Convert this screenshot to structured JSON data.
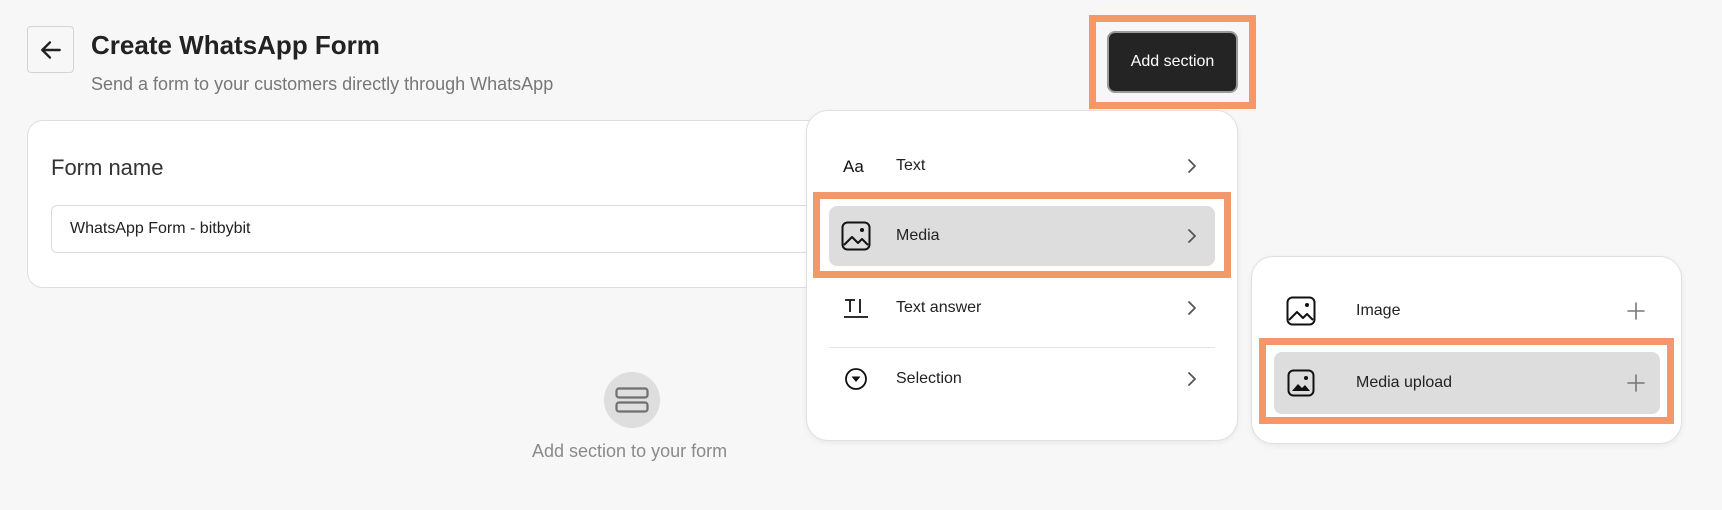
{
  "header": {
    "title": "Create WhatsApp Form",
    "subtitle": "Send a form to your customers directly through WhatsApp"
  },
  "form": {
    "label": "Form name",
    "value": "WhatsApp Form - bitbybit"
  },
  "empty_state": {
    "text": "Add section to your form"
  },
  "toolbar": {
    "add_section_label": "Add section"
  },
  "menu": {
    "items": [
      {
        "label": "Text",
        "icon": "text-format-icon"
      },
      {
        "label": "Media",
        "icon": "image-icon"
      },
      {
        "label": "Text answer",
        "icon": "text-input-icon"
      },
      {
        "label": "Selection",
        "icon": "dropdown-circle-icon"
      }
    ]
  },
  "submenu": {
    "items": [
      {
        "label": "Image",
        "icon": "image-icon"
      },
      {
        "label": "Media upload",
        "icon": "image-filled-icon"
      }
    ]
  },
  "colors": {
    "highlight": "#f4986a",
    "primary_button": "#242424",
    "active_item": "#dddddd"
  }
}
